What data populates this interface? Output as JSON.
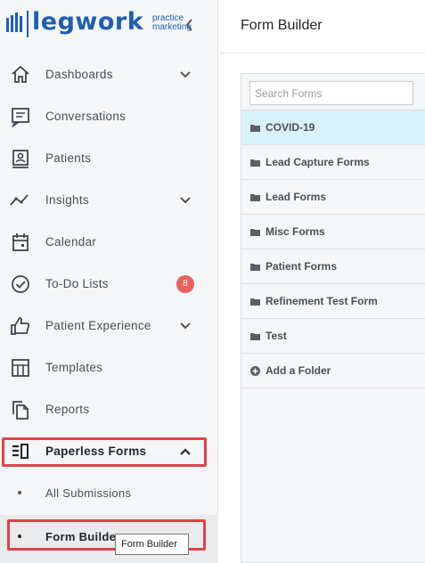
{
  "brand": {
    "name": "legwork",
    "sub_line1": "practice",
    "sub_line2": "marketing",
    "color": "#1e5fb3"
  },
  "sidebar": {
    "collapse_icon": "chevron-left-icon",
    "items": [
      {
        "label": "Dashboards",
        "icon": "home-icon",
        "has_chevron": true
      },
      {
        "label": "Conversations",
        "icon": "message-icon"
      },
      {
        "label": "Patients",
        "icon": "patient-card-icon"
      },
      {
        "label": "Insights",
        "icon": "trend-line-icon",
        "has_chevron": true
      },
      {
        "label": "Calendar",
        "icon": "calendar-icon"
      },
      {
        "label": "To-Do Lists",
        "icon": "check-circle-icon",
        "badge": "8"
      },
      {
        "label": "Patient Experience",
        "icon": "thumbs-up-icon",
        "has_chevron": true
      },
      {
        "label": "Templates",
        "icon": "template-grid-icon"
      },
      {
        "label": "Reports",
        "icon": "copy-document-icon"
      },
      {
        "label": "Paperless Forms",
        "icon": "form-list-icon",
        "expanded": true
      }
    ],
    "sub_items": [
      {
        "label": "All Submissions"
      },
      {
        "label": "Form Builde"
      }
    ],
    "tooltip": "Form Builder",
    "badge_color": "#e8615c",
    "highlight_color": "#e0424a"
  },
  "main": {
    "title": "Form Builder",
    "search": {
      "placeholder": "Search Forms",
      "value": ""
    },
    "folders": [
      {
        "label": "COVID-19",
        "selected": true
      },
      {
        "label": "Lead Capture Forms"
      },
      {
        "label": "Lead Forms"
      },
      {
        "label": "Misc Forms"
      },
      {
        "label": "Patient Forms"
      },
      {
        "label": "Refinement Test Form"
      },
      {
        "label": "Test"
      }
    ],
    "add_folder_label": "Add a Folder",
    "selected_color": "#d9f1fb"
  }
}
